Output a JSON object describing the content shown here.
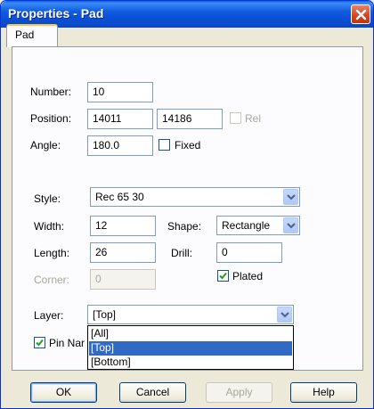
{
  "window": {
    "title": "Properties - Pad"
  },
  "tabs": [
    {
      "label": "Pad",
      "active": true
    }
  ],
  "fields": {
    "number_label": "Number:",
    "number_value": "10",
    "position_label": "Position:",
    "position_x": "14011",
    "position_y": "14186",
    "rel_label": "Rel",
    "rel_checked": false,
    "angle_label": "Angle:",
    "angle_value": "180.0",
    "fixed_label": "Fixed",
    "fixed_checked": false,
    "style_label": "Style:",
    "style_value": "Rec 65 30",
    "width_label": "Width:",
    "width_value": "12",
    "shape_label": "Shape:",
    "shape_value": "Rectangle",
    "length_label": "Length:",
    "length_value": "26",
    "drill_label": "Drill:",
    "drill_value": "0",
    "corner_label": "Corner:",
    "corner_value": "0",
    "plated_label": "Plated",
    "plated_checked": true,
    "layer_label": "Layer:",
    "layer_value": "[Top]",
    "pin_name_label": "Pin Nar",
    "pin_name_checked": true
  },
  "layer_dropdown": {
    "options": [
      "[All]",
      "[Top]",
      "[Bottom]"
    ],
    "selected_index": 1
  },
  "buttons": {
    "ok": "OK",
    "cancel": "Cancel",
    "apply": "Apply",
    "help": "Help"
  },
  "colors": {
    "titlebar": "#0a4fd3",
    "selection": "#316ac5",
    "check": "#21a121"
  }
}
